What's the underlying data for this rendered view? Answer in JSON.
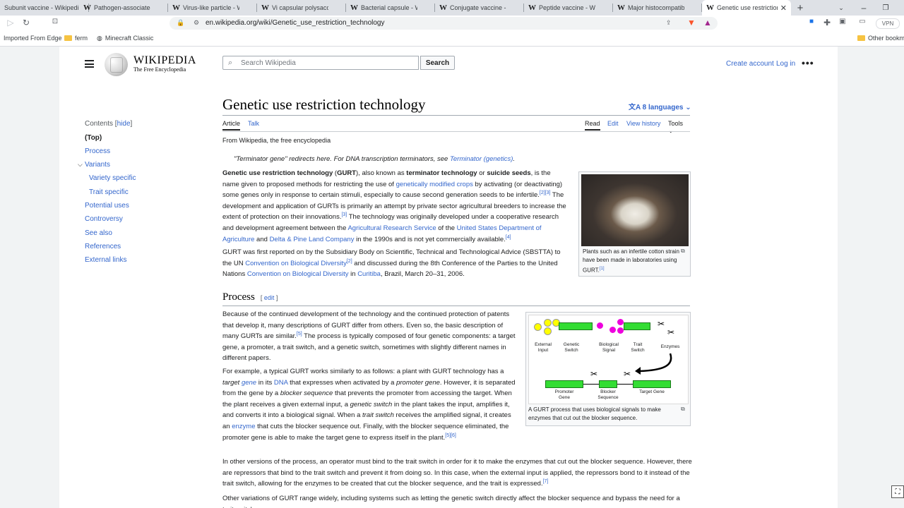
{
  "browser": {
    "tabs": [
      {
        "label": "Subunit vaccine - Wikipedia",
        "active": false
      },
      {
        "label": "Pathogen-associated molec",
        "active": false
      },
      {
        "label": "Virus-like particle - Wikiped",
        "active": false
      },
      {
        "label": "Vi capsular polysaccharide",
        "active": false
      },
      {
        "label": "Bacterial capsule - Wikiped",
        "active": false
      },
      {
        "label": "Conjugate vaccine - Wikipe",
        "active": false
      },
      {
        "label": "Peptide vaccine - Wikipedia",
        "active": false
      },
      {
        "label": "Major histocompatibility co",
        "active": false
      },
      {
        "label": "Genetic use restriction",
        "active": true
      }
    ],
    "new_tab": "+",
    "url": "en.wikipedia.org/wiki/Genetic_use_restriction_technology",
    "vpn_label": "VPN",
    "bookmarks": {
      "imported": "Imported From Edge",
      "ferm": "ferm",
      "minecraft": "Minecraft Classic",
      "other": "Other bookm"
    }
  },
  "header": {
    "wordmark": "WIKIPEDIA",
    "tagline": "The Free Encyclopedia",
    "search_placeholder": "Search Wikipedia",
    "search_button": "Search",
    "create_account": "Create account",
    "log_in": "Log in"
  },
  "toc": {
    "title": "Contents",
    "hide": "hide",
    "items": [
      "(Top)",
      "Process",
      "Variants",
      "Variety specific",
      "Trait specific",
      "Potential uses",
      "Controversy",
      "See also",
      "References",
      "External links"
    ]
  },
  "article": {
    "title": "Genetic use restriction technology",
    "languages": "8 languages",
    "tab_article": "Article",
    "tab_talk": "Talk",
    "tab_read": "Read",
    "tab_edit": "Edit",
    "tab_history": "View history",
    "tab_tools": "Tools",
    "from": "From Wikipedia, the free encyclopedia",
    "hatnote_pre": "\"Terminator gene\" redirects here. For DNA transcription terminators, see ",
    "hatnote_link": "Terminator (genetics)",
    "section_process": "Process",
    "edit_label": "edit",
    "fig1_caption": "Plants such as an infertile cotton strain have been made in laboratories using GURT.",
    "fig1_ref": "[1]",
    "fig2_caption": "A GURT process that uses biological signals to make enzymes that cut out the blocker sequence.",
    "diagram": {
      "external_input": "External Input",
      "genetic_switch": "Genetic Switch",
      "biological_signal": "Biological Signal",
      "trait_switch": "Trait Switch",
      "enzymes": "Enzymes",
      "promoter_gene": "Promoter Gene",
      "blocker_sequence": "Blocker Sequence",
      "target_gene": "Target Gene"
    }
  }
}
